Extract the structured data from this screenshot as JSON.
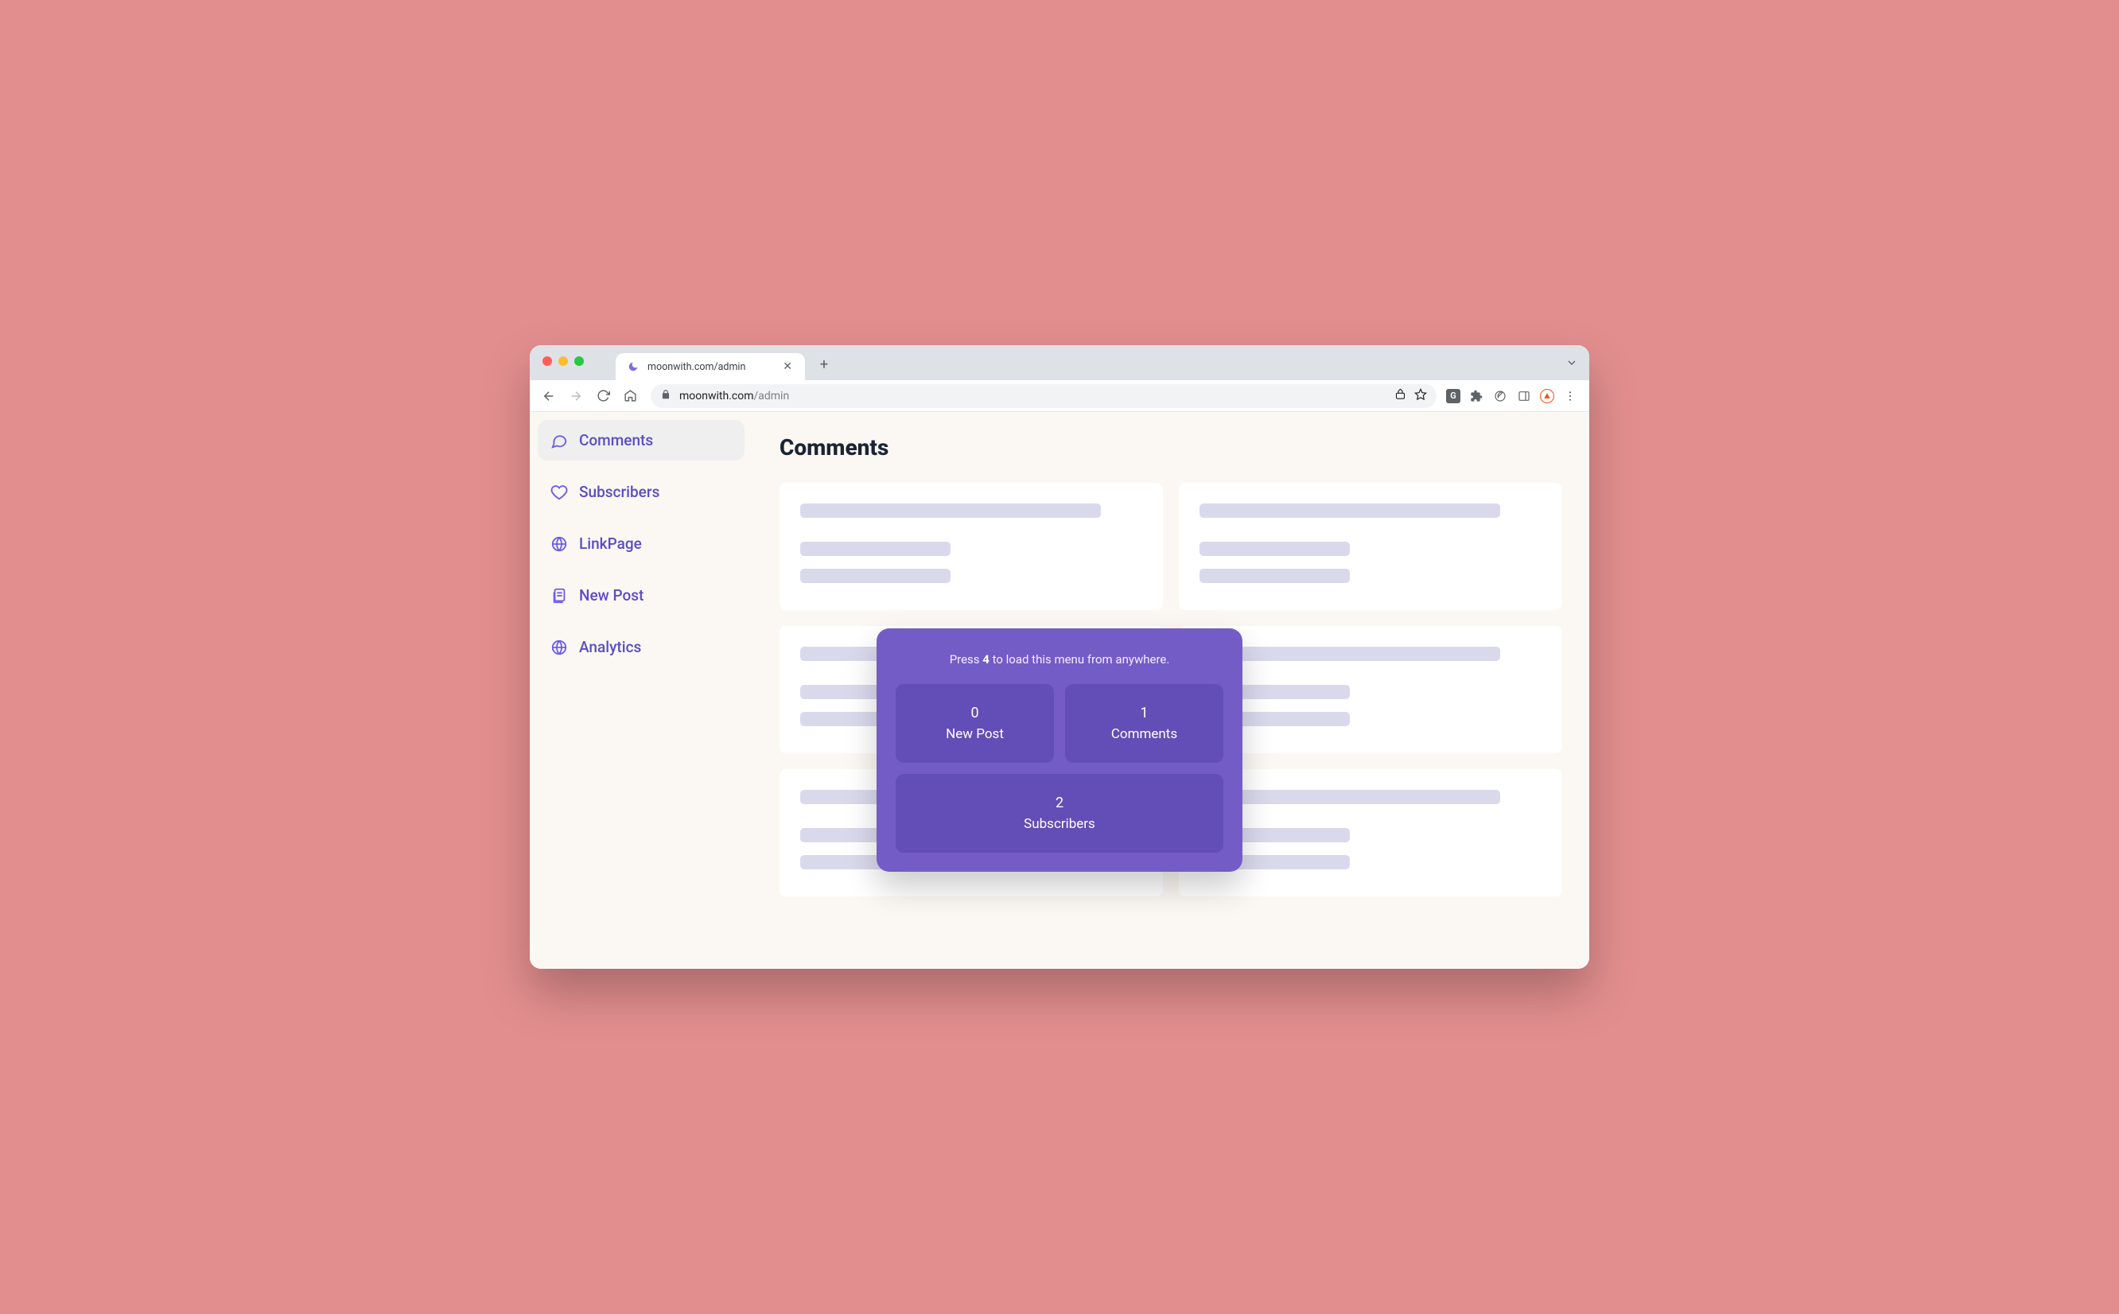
{
  "browser": {
    "tab_title": "moonwith.com/admin",
    "url_host": "moonwith.com",
    "url_path": "/admin"
  },
  "sidebar": {
    "items": [
      {
        "label": "Comments",
        "active": true
      },
      {
        "label": "Subscribers",
        "active": false
      },
      {
        "label": "LinkPage",
        "active": false
      },
      {
        "label": "New Post",
        "active": false
      },
      {
        "label": "Analytics",
        "active": false
      }
    ]
  },
  "page": {
    "title": "Comments"
  },
  "overlay": {
    "hint_pre": "Press ",
    "hint_key": "4",
    "hint_post": " to load this menu from anywhere.",
    "cards": [
      {
        "number": "0",
        "label": "New Post"
      },
      {
        "number": "1",
        "label": "Comments"
      },
      {
        "number": "2",
        "label": "Subscribers"
      }
    ]
  }
}
